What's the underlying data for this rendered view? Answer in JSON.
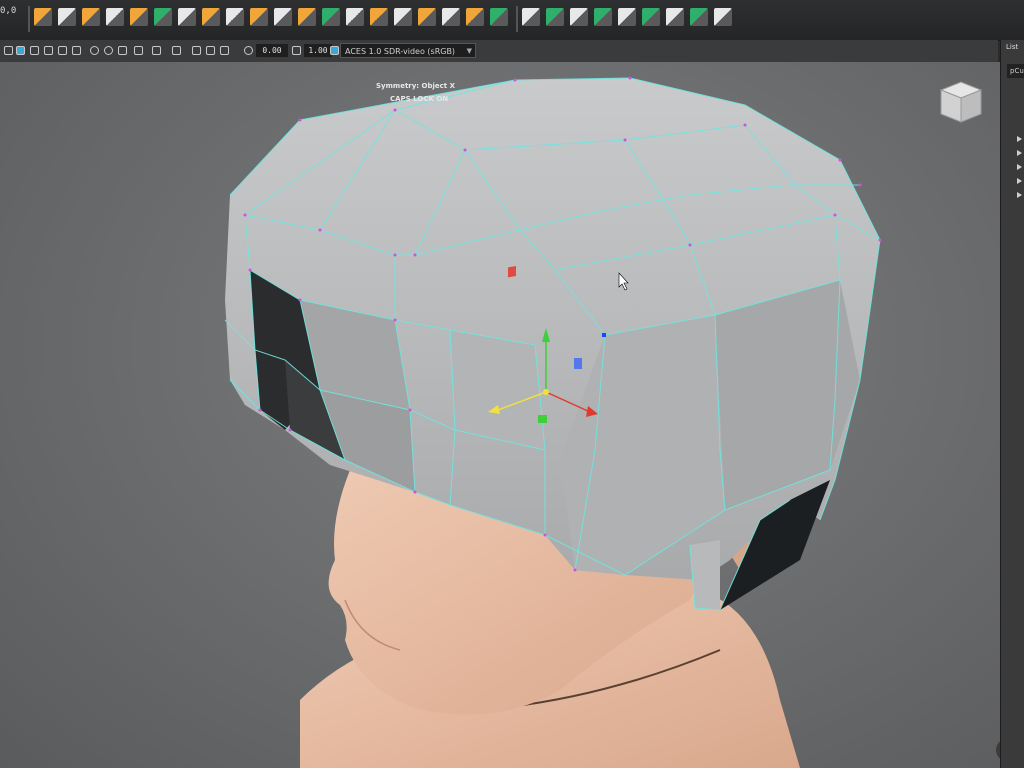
{
  "shelf": {
    "coord_label": "0,0",
    "icons": [
      "select-icon",
      "lasso-icon",
      "paint-select-icon",
      "move-icon",
      "rotate-icon",
      "scale-icon",
      "snap-grid-icon",
      "snap-curve-icon",
      "snap-point-icon",
      "snap-view-icon",
      "bevel-icon",
      "extrude-icon",
      "bridge-icon",
      "append-icon",
      "multicut-icon",
      "target-weld-icon",
      "merge-icon",
      "smooth-icon",
      "mirror-icon",
      "combine-icon",
      "separate-icon",
      "boolean-icon",
      "uv-icon",
      "sculpt-icon",
      "edit-tool-icon",
      "insert-loop-icon",
      "offset-loop-icon",
      "quad-draw-icon",
      "crease-icon"
    ]
  },
  "panel_toolbar": {
    "value_a": "0.00",
    "value_b": "1.00",
    "color_space": "ACES 1.0 SDR-video (sRGB)"
  },
  "viewport": {
    "symmetry_text": "Symmetry: Object X",
    "caps_lock_text": "CAPS LOCK ON",
    "view_cube_label": "view-cube-icon",
    "mesh_wire_color": "#6fe6e0",
    "skin_color": "#e6bca4"
  },
  "right_panel": {
    "list_label": "List",
    "selected_item": "pCu"
  },
  "colors": {
    "gizmo_x": "#e03a2f",
    "gizmo_y": "#3fcf3a",
    "gizmo_z": "#4a6ff0",
    "gizmo_center": "#f0e040"
  }
}
